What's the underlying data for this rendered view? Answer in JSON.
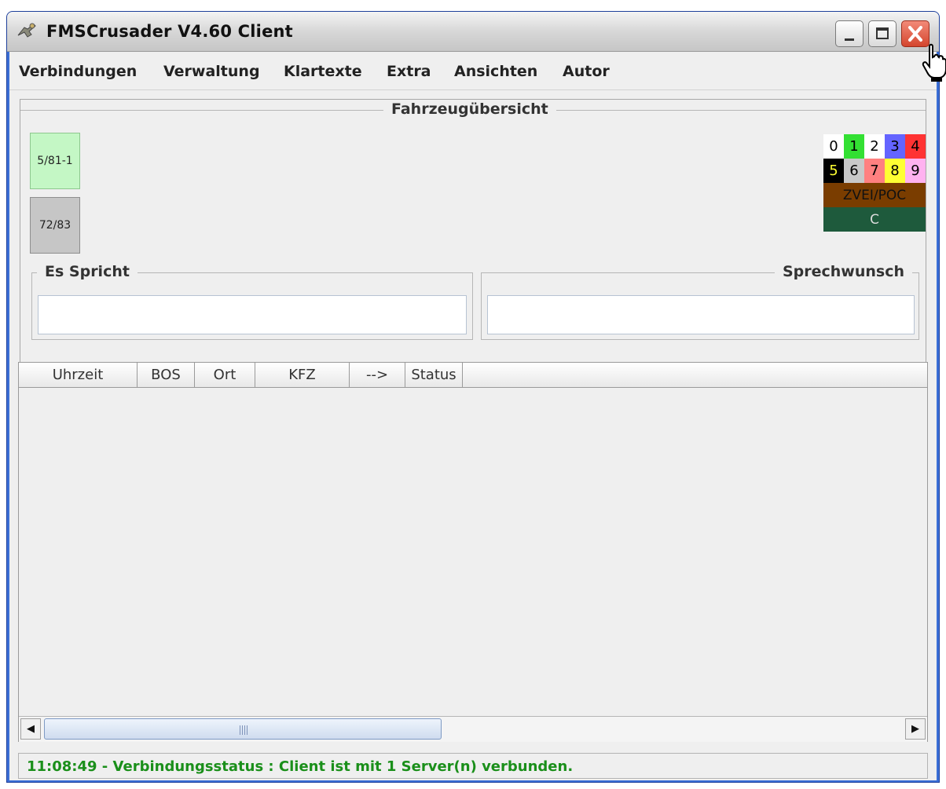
{
  "window": {
    "title": "FMSCrusader V4.60 Client",
    "icons": {
      "app": "tool-icon",
      "minimize": "minimize-icon",
      "maximize": "maximize-icon",
      "close": "close-icon"
    }
  },
  "menu": {
    "items": [
      {
        "label": "Verbindungen"
      },
      {
        "label": "Verwaltung"
      },
      {
        "label": "Klartexte"
      },
      {
        "label": "Extra"
      },
      {
        "label": "Ansichten"
      },
      {
        "label": "Autor"
      }
    ]
  },
  "overview": {
    "title": "Fahrzeugübersicht",
    "vehicles": [
      {
        "label": "5/81-1",
        "color": "#c4f7c5"
      },
      {
        "label": "72/83",
        "color": "#c6c6c6"
      }
    ],
    "status_codes": [
      {
        "label": "0",
        "bg": "#ffffff",
        "fg": "#000000"
      },
      {
        "label": "1",
        "bg": "#33e033",
        "fg": "#000000"
      },
      {
        "label": "2",
        "bg": "#ffffff",
        "fg": "#000000"
      },
      {
        "label": "3",
        "bg": "#6464ff",
        "fg": "#000000"
      },
      {
        "label": "4",
        "bg": "#ff3333",
        "fg": "#000000"
      },
      {
        "label": "5",
        "bg": "#000000",
        "fg": "#ffff33"
      },
      {
        "label": "6",
        "bg": "#c8c8c8",
        "fg": "#000000"
      },
      {
        "label": "7",
        "bg": "#ff8080",
        "fg": "#000000"
      },
      {
        "label": "8",
        "bg": "#ffff33",
        "fg": "#000000"
      },
      {
        "label": "9",
        "bg": "#ffb2f0",
        "fg": "#000000"
      }
    ],
    "zvei_label": "ZVEI/POC",
    "zvei_color": "#7a3d00",
    "c_label": "C",
    "c_color": "#1e5a3c"
  },
  "es_spricht": {
    "title": "Es Spricht",
    "value": ""
  },
  "sprechwunsch": {
    "title": "Sprechwunsch",
    "value": ""
  },
  "table": {
    "columns": [
      {
        "label": "Uhrzeit"
      },
      {
        "label": "BOS"
      },
      {
        "label": "Ort"
      },
      {
        "label": "KFZ"
      },
      {
        "label": "-->"
      },
      {
        "label": "Status"
      }
    ],
    "rows": []
  },
  "statusbar": {
    "text": "11:08:49 - Verbindungsstatus : Client ist mit 1 Server(n) verbunden.",
    "color": "#1a8f1a"
  }
}
